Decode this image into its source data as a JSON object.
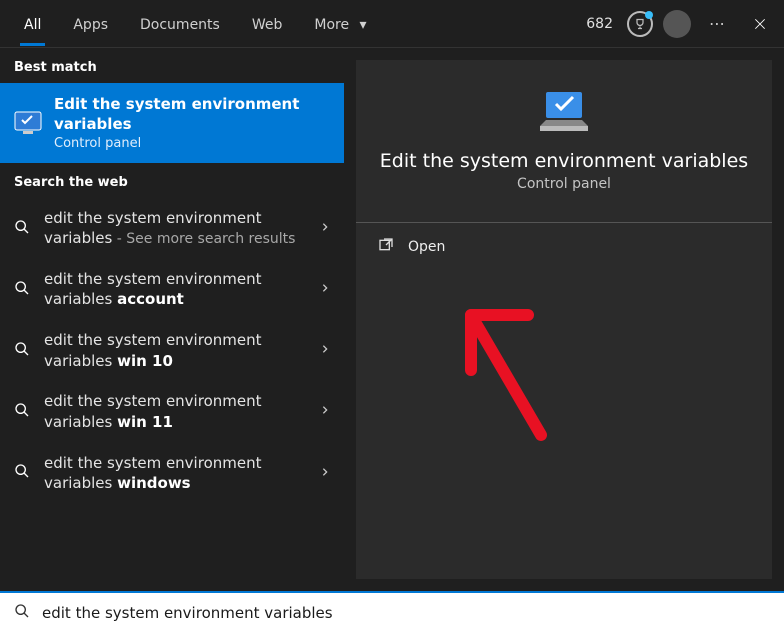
{
  "scope": {
    "tabs": [
      "All",
      "Apps",
      "Documents",
      "Web",
      "More"
    ],
    "active_index": 0,
    "points": "682"
  },
  "sections": {
    "best_match": "Best match",
    "search_web": "Search the web"
  },
  "best": {
    "title": "Edit the system environment variables",
    "subtitle": "Control panel"
  },
  "web_results": [
    {
      "prefix": "edit the system environment variables",
      "bold": "",
      "suffix": " - See more search results"
    },
    {
      "prefix": "edit the system environment variables ",
      "bold": "account",
      "suffix": ""
    },
    {
      "prefix": "edit the system environment variables ",
      "bold": "win 10",
      "suffix": ""
    },
    {
      "prefix": "edit the system environment variables ",
      "bold": "win 11",
      "suffix": ""
    },
    {
      "prefix": "edit the system environment variables ",
      "bold": "windows",
      "suffix": ""
    }
  ],
  "preview": {
    "title": "Edit the system environment variables",
    "subtitle": "Control panel",
    "actions": {
      "open": "Open"
    }
  },
  "search_input": {
    "value": "edit the system environment variables"
  }
}
